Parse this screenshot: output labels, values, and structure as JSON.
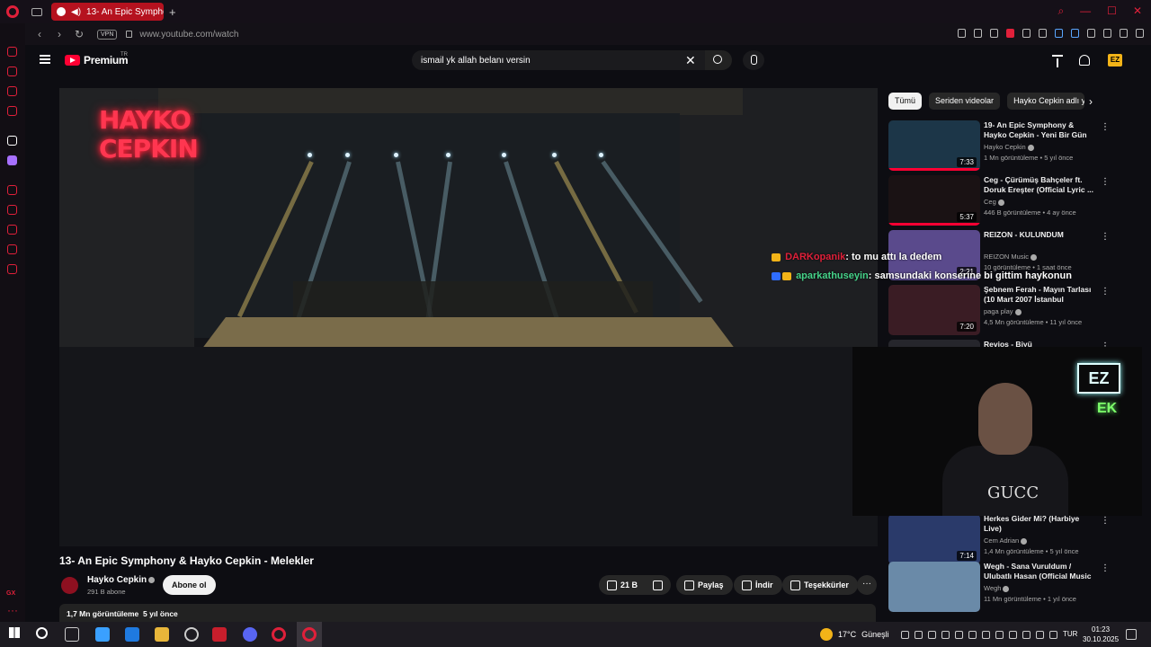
{
  "browser": {
    "tab_title": "13- An Epic Symphony",
    "new_tab": "+",
    "vpn": "VPN",
    "url": "www.youtube.com/watch",
    "sidebar_gx": "GX",
    "sidebar_more": "···"
  },
  "youtube": {
    "logo_text": "Premium",
    "logo_region": "TR",
    "search_value": "ismail yk allah belanı versin",
    "avatar_text": "EZ"
  },
  "video": {
    "neon_line1": "HAYKO",
    "neon_line2": "CEPKIN",
    "title": "13- An Epic Symphony & Hayko Cepkin - Melekler",
    "channel": "Hayko Cepkin",
    "subscribers": "291 B abone",
    "subscribe_label": "Abone ol",
    "likes": "21 B",
    "share_label": "Paylaş",
    "download_label": "İndir",
    "thanks_label": "Teşekkürler",
    "more_label": "···",
    "views": "1,7 Mn görüntüleme",
    "age": "5 yıl önce"
  },
  "chat": [
    {
      "user": "DARKopanik",
      "message": ": to mu attı la dedem"
    },
    {
      "user": "aparkathuseyin",
      "message": ": samsundaki konserine bi gittim haykonun"
    }
  ],
  "chips": [
    "Tümü",
    "Seriden videolar",
    "Hayko Cepkin adlı yükleyicinin videoları"
  ],
  "recommendations": [
    {
      "title": "19- An Epic Symphony & Hayko Cepkin - Yeni Bir Gün",
      "channel": "Hayko Cepkin",
      "meta": "1 Mn görüntüleme • 5 yıl önce",
      "duration": "7:33",
      "thumb_color": "#1c3648",
      "progress": 1.0
    },
    {
      "title": "Ceg - Çürümüş Bahçeler ft. Doruk Ereşter (Official Lyric ...",
      "channel": "Ceg",
      "meta": "446 B görüntüleme • 4 ay önce",
      "duration": "5:37",
      "thumb_color": "#1a1214",
      "progress": 1.0
    },
    {
      "title": "REIZON - KULUNDUM",
      "channel": "REIZON Music",
      "meta": "10 görüntüleme • 1 saat önce",
      "duration": "2:21",
      "thumb_color": "#5a4a8c",
      "progress": 0.0
    },
    {
      "title": "Şebnem Ferah - Mayın Tarlası (10 Mart 2007 İstanbul Konseri)",
      "channel": "paga play",
      "meta": "4,5 Mn görüntüleme • 11 yıl önce",
      "duration": "7:20",
      "thumb_color": "#3a1c24",
      "progress": 0.0
    },
    {
      "title": "Revios - Biyü",
      "channel": "",
      "meta": "",
      "duration": "",
      "thumb_color": "#26262c",
      "progress": 0.0
    },
    {
      "title": "Herkes Gider Mi? (Harbiye Live)",
      "channel": "Cem Adrian",
      "meta": "1,4 Mn görüntüleme • 5 yıl önce",
      "duration": "7:14",
      "thumb_color": "#2a3a6a",
      "progress": 0.0
    },
    {
      "title": "Wegh - Sana Vuruldum / Ulubatlı Hasan (Official Music ...",
      "channel": "Wegh",
      "meta": "11 Mn görüntüleme • 1 yıl önce",
      "duration": "",
      "thumb_color": "#6a8aa8",
      "progress": 0.0
    }
  ],
  "webcam": {
    "neon_sign": "EZ",
    "neon_green": "EK",
    "shirt_text": "GUCC"
  },
  "taskbar": {
    "temperature": "17°C",
    "weather": "Güneşli",
    "language": "TUR",
    "time": "01:23",
    "date": "30.10.2025"
  }
}
